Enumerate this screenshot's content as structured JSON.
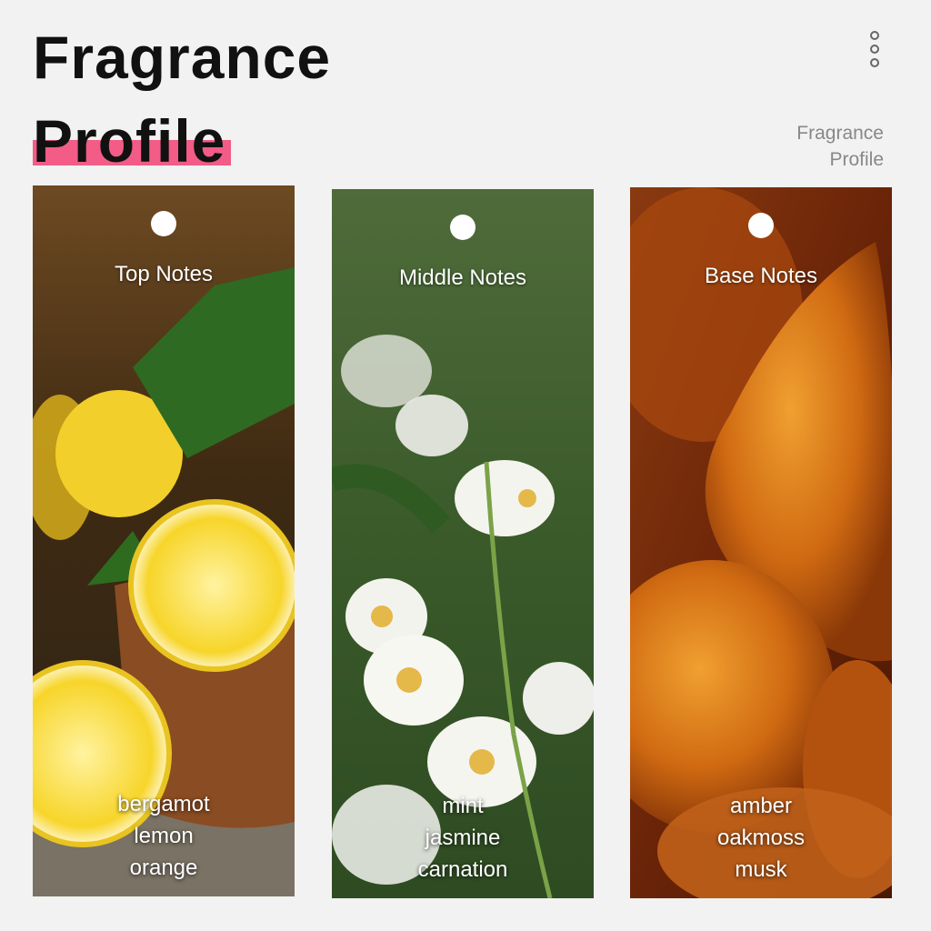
{
  "header": {
    "title_line1": "Fragrance",
    "title_line2": "Profile",
    "side_line1": "Fragrance",
    "side_line2": "Profile",
    "accent_color": "#f25c86",
    "menu_icon": "more-vertical-icon"
  },
  "cards": [
    {
      "label": "Top Notes",
      "notes": [
        "bergamot",
        "lemon",
        "orange"
      ],
      "image": "lemons-mint-wooden-bowl"
    },
    {
      "label": "Middle Notes",
      "notes": [
        "mint",
        "jasmine",
        "carnation"
      ],
      "image": "jasmine-flowers"
    },
    {
      "label": "Base Notes",
      "notes": [
        "amber",
        "oakmoss",
        "musk"
      ],
      "image": "amber-stones"
    }
  ]
}
